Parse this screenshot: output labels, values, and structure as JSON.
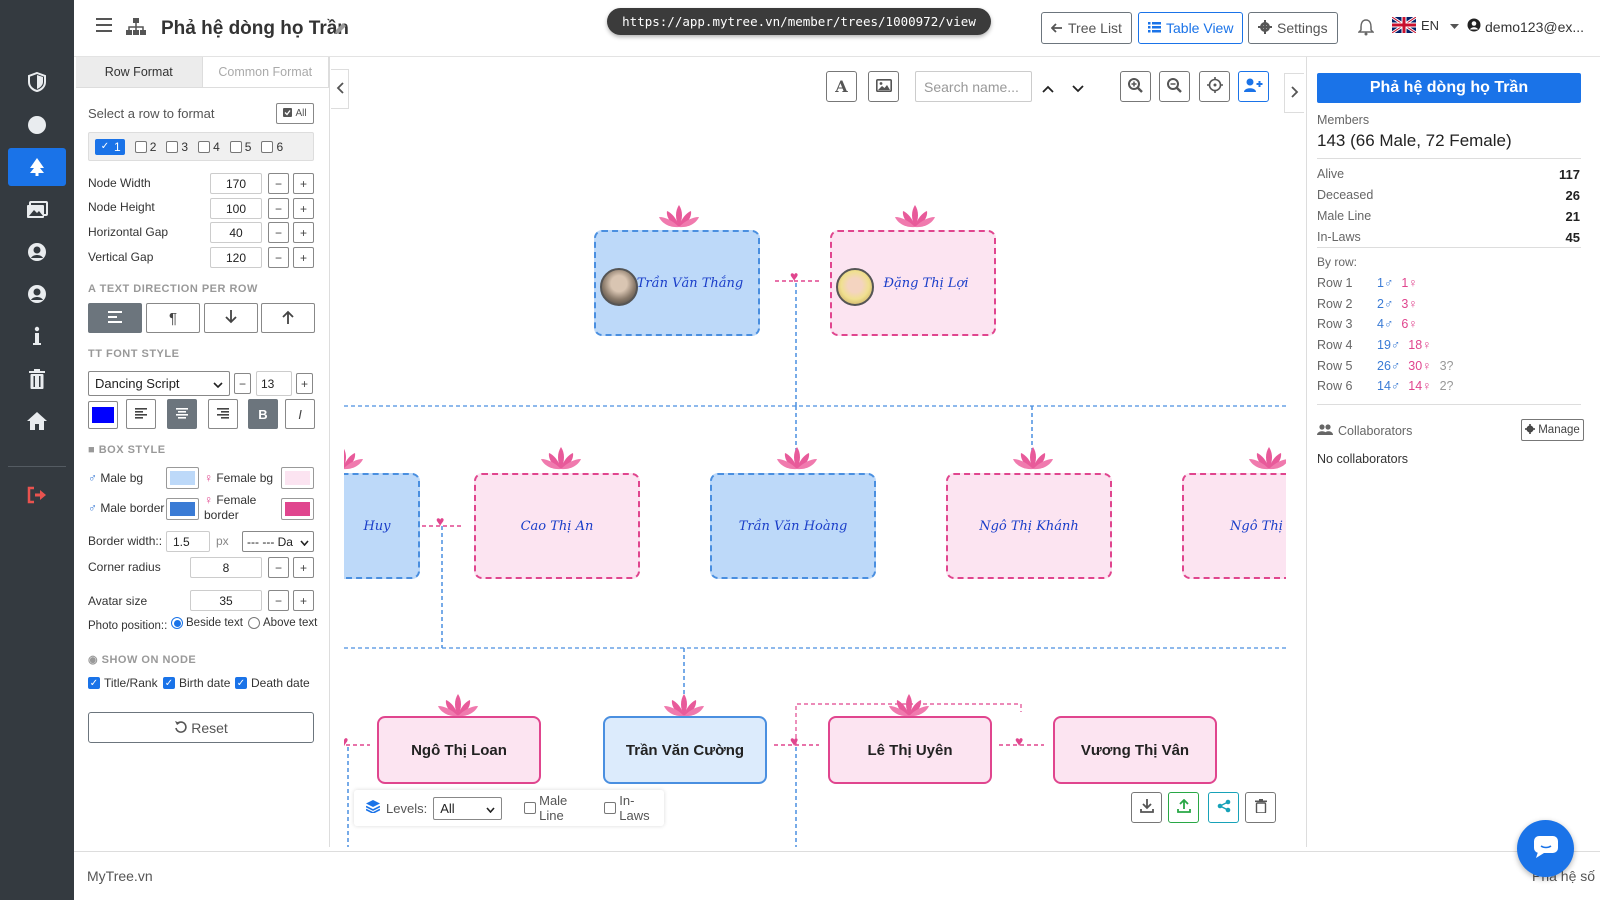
{
  "header": {
    "title": "Phả hệ dòng họ Trần",
    "url": "https://app.mytree.vn/member/trees/1000972/view",
    "tree_list_label": "Tree List",
    "table_view_label": "Table View",
    "settings_label": "Settings",
    "language": "EN",
    "user": "demo123@ex..."
  },
  "panel": {
    "tabs": [
      "Row Format",
      "Common Format"
    ],
    "select_row_label": "Select a row to format",
    "all_label": "All",
    "rows": [
      "1",
      "2",
      "3",
      "4",
      "5",
      "6"
    ],
    "dims": [
      {
        "label": "Node Width",
        "value": "170"
      },
      {
        "label": "Node Height",
        "value": "100"
      },
      {
        "label": "Horizontal Gap",
        "value": "40"
      },
      {
        "label": "Vertical Gap",
        "value": "120"
      }
    ],
    "text_direction_heading": "TEXT DIRECTION PER ROW",
    "font_style_heading": "FONT STYLE",
    "font_family": "Dancing Script",
    "font_size": "13",
    "text_color": "#0000ff",
    "bold_label": "B",
    "italic_label": "I",
    "box_style_heading": "BOX STYLE",
    "male_bg_label": "Male bg",
    "female_bg_label": "Female bg",
    "male_border_label": "Male border",
    "female_border_label": "Female border",
    "male_bg_color": "#bdd9f9",
    "female_bg_color": "#fce4f1",
    "male_border_color": "#3a7bd5",
    "female_border_color": "#e0458e",
    "border_width_label": "Border width::",
    "border_width_value": "1.5",
    "border_width_unit": "px",
    "border_style_value": "--- --- Da",
    "corner_radius_label": "Corner radius",
    "corner_radius_value": "8",
    "avatar_size_label": "Avatar size",
    "avatar_size_value": "35",
    "photo_position_label": "Photo position::",
    "photo_beside_label": "Beside text",
    "photo_above_label": "Above text",
    "show_on_node_heading": "SHOW ON NODE",
    "show_title_label": "Title/Rank",
    "show_birth_label": "Birth date",
    "show_death_label": "Death date",
    "reset_label": "Reset"
  },
  "canvas": {
    "search_placeholder": "Search name...",
    "text_tool_label": "A",
    "row1": [
      {
        "name": "Trần Văn Thắng",
        "gender": "male"
      },
      {
        "name": "Đặng Thị Lợi",
        "gender": "female"
      }
    ],
    "row2": [
      {
        "name": "Huy",
        "gender": "male"
      },
      {
        "name": "Cao Thị An",
        "gender": "female"
      },
      {
        "name": "Trần Văn Hoàng",
        "gender": "male"
      },
      {
        "name": "Ngô Thị Khánh",
        "gender": "female"
      },
      {
        "name": "Ngô Thị",
        "gender": "female"
      }
    ],
    "row3": [
      {
        "name": "Ngô Thị Loan",
        "gender": "female"
      },
      {
        "name": "Trần Văn Cường",
        "gender": "male"
      },
      {
        "name": "Lê Thị Uyên",
        "gender": "female"
      },
      {
        "name": "Vương Thị Vân",
        "gender": "female"
      }
    ],
    "levels_label": "Levels:",
    "levels_value": "All",
    "male_line_label": "Male Line",
    "in_laws_label": "In-Laws"
  },
  "stats": {
    "title": "Phả hệ dòng họ Trần",
    "members_label": "Members",
    "members_value": "143 (66 Male, 72 Female)",
    "items": [
      {
        "label": "Alive",
        "value": "117"
      },
      {
        "label": "Deceased",
        "value": "26"
      },
      {
        "label": "Male Line",
        "value": "21"
      },
      {
        "label": "In-Laws",
        "value": "45"
      }
    ],
    "by_row_label": "By row:",
    "rows": [
      {
        "label": "Row 1",
        "male": "1♂",
        "female": "1♀",
        "unknown": ""
      },
      {
        "label": "Row 2",
        "male": "2♂",
        "female": "3♀",
        "unknown": ""
      },
      {
        "label": "Row 3",
        "male": "4♂",
        "female": "6♀",
        "unknown": ""
      },
      {
        "label": "Row 4",
        "male": "19♂",
        "female": "18♀",
        "unknown": ""
      },
      {
        "label": "Row 5",
        "male": "26♂",
        "female": "30♀",
        "unknown": "3?"
      },
      {
        "label": "Row 6",
        "male": "14♂",
        "female": "14♀",
        "unknown": "2?"
      }
    ],
    "collaborators_label": "Collaborators",
    "manage_label": "Manage",
    "no_collaborators": "No collaborators"
  },
  "footer": {
    "left": "MyTree.vn",
    "right": "Phả hệ số"
  }
}
